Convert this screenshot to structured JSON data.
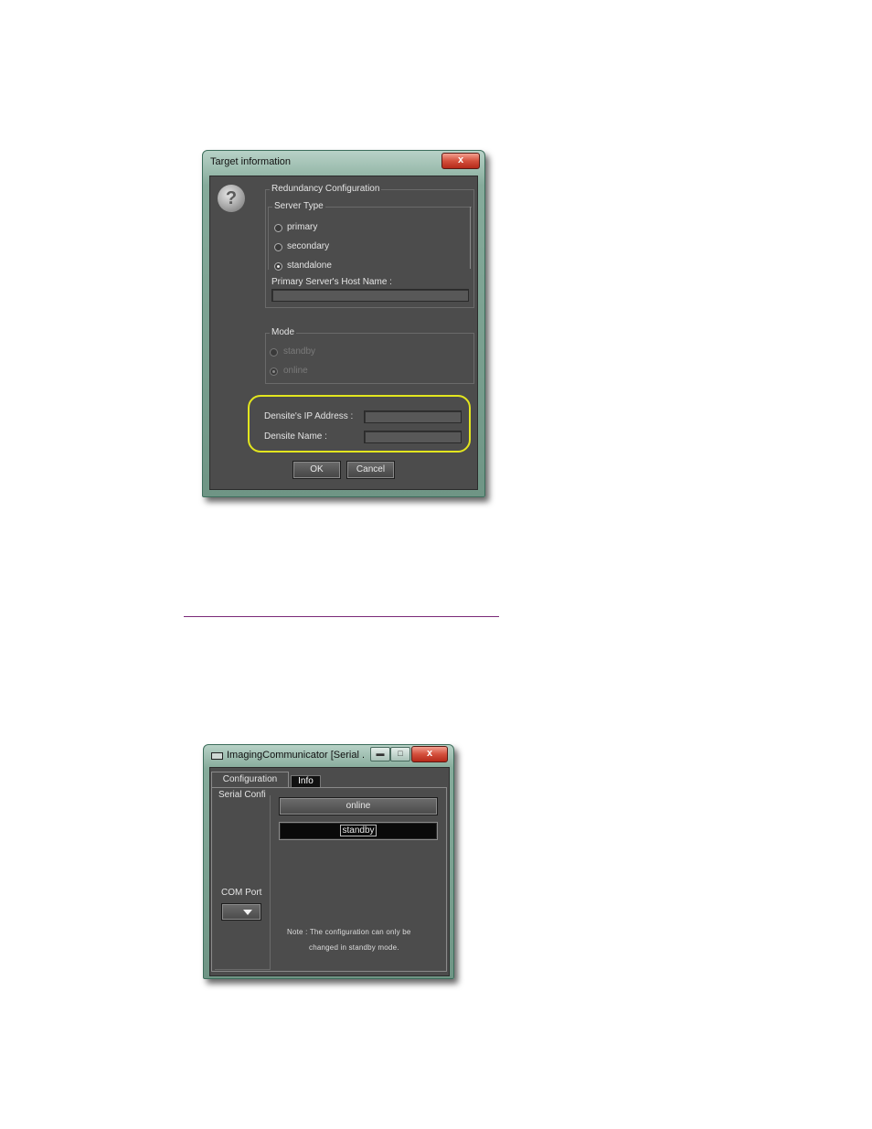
{
  "target_dialog": {
    "title": "Target information",
    "close_label": "x",
    "redundancy_group": "Redundancy Configuration",
    "server_type_group": "Server Type",
    "server_types": [
      {
        "label": "primary",
        "selected": false
      },
      {
        "label": "secondary",
        "selected": false
      },
      {
        "label": "standalone",
        "selected": true
      }
    ],
    "primary_host_label": "Primary Server's Host Name :",
    "primary_host_value": "",
    "mode_group": "Mode",
    "modes": [
      {
        "label": "standby",
        "selected": false,
        "enabled": false
      },
      {
        "label": "online",
        "selected": true,
        "enabled": false
      }
    ],
    "ip_label": "Densite's IP Address :",
    "ip_value": "",
    "name_label": "Densite Name :",
    "name_value": "",
    "ok_label": "OK",
    "cancel_label": "Cancel",
    "highlight_color": "#e3e61e"
  },
  "imaging_window": {
    "title": "ImagingCommunicator [Serial ...",
    "close_label": "x",
    "tabs": [
      {
        "label": "Configuration",
        "active": true
      },
      {
        "label": "Info",
        "active": false
      }
    ],
    "serial_group": "Serial Confi",
    "com_port_label": "COM Port",
    "online_label": "online",
    "standby_label": "standby",
    "note_line1": "Note : The configuration can only be",
    "note_line2": "changed in standby mode."
  }
}
